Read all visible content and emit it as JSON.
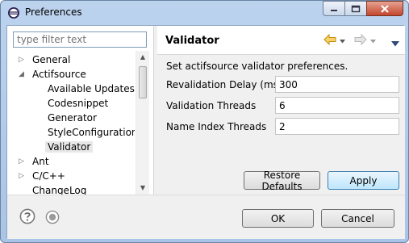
{
  "window": {
    "title": "Preferences",
    "icon": "eclipse-icon"
  },
  "filter": {
    "placeholder": "type filter text",
    "value": ""
  },
  "tree": {
    "items": [
      {
        "label": "General",
        "expandable": true,
        "expanded": false,
        "level": 0
      },
      {
        "label": "Actifsource",
        "expandable": true,
        "expanded": true,
        "level": 0
      },
      {
        "label": "Available Updates",
        "level": 1
      },
      {
        "label": "Codesnippet",
        "level": 1
      },
      {
        "label": "Generator",
        "level": 1
      },
      {
        "label": "StyleConfiguration",
        "level": 1
      },
      {
        "label": "Validator",
        "level": 1,
        "selected": true
      },
      {
        "label": "Ant",
        "expandable": true,
        "expanded": false,
        "level": 0
      },
      {
        "label": "C/C++",
        "expandable": true,
        "expanded": false,
        "level": 0
      },
      {
        "label": "ChangeLog",
        "level": 0
      }
    ]
  },
  "page": {
    "title": "Validator",
    "description": "Set actifsource validator preferences.",
    "fields": [
      {
        "label": "Revalidation Delay (ms)",
        "value": "300"
      },
      {
        "label": "Validation Threads",
        "value": "6"
      },
      {
        "label": "Name Index Threads",
        "value": "2"
      }
    ],
    "restore_defaults_label": "Restore Defaults",
    "apply_label": "Apply"
  },
  "footer": {
    "ok_label": "OK",
    "cancel_label": "Cancel"
  },
  "colors": {
    "accent_arrow": "#e8a516",
    "nav_disabled": "#b8b8b8",
    "nav_menu": "#2d4a78"
  }
}
